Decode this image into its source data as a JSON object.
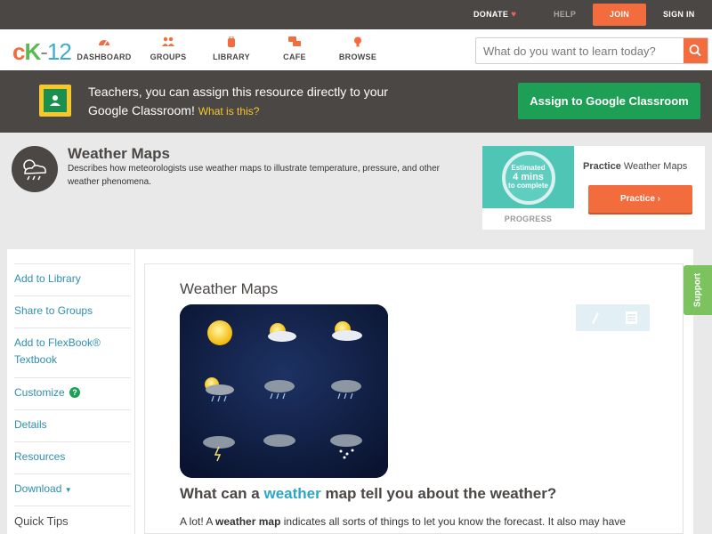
{
  "topbar": {
    "donate": "DONATE",
    "help": "HELP",
    "join": "JOIN",
    "signin": "SIGN IN"
  },
  "nav": {
    "logo": {
      "c": "c",
      "k": "K",
      "dash": "-",
      "num": "12"
    },
    "items": [
      {
        "label": "DASHBOARD",
        "icon": "speedometer-icon"
      },
      {
        "label": "GROUPS",
        "icon": "people-icon"
      },
      {
        "label": "LIBRARY",
        "icon": "backpack-icon"
      },
      {
        "label": "CAFE",
        "icon": "chat-bubbles-icon"
      },
      {
        "label": "BROWSE",
        "icon": "lightbulb-icon"
      }
    ],
    "search_placeholder": "What do you want to learn today?"
  },
  "banner": {
    "message": "Teachers, you can assign this resource directly to your Google Classroom!",
    "what_link": "What is this?",
    "assign_button": "Assign to Google Classroom"
  },
  "concept": {
    "title": "Weather Maps",
    "description": "Describes how meteorologists use weather maps to illustrate temperature, pressure, and other weather phenomena."
  },
  "practice": {
    "estimated": "Estimated",
    "minutes": "4 mins",
    "to_complete": "to complete",
    "progress_label": "PROGRESS",
    "title_bold": "Practice",
    "title_rest": "Weather Maps",
    "button": "Practice"
  },
  "sidebar": {
    "items": [
      {
        "label": "Add to Library"
      },
      {
        "label": "Share to Groups"
      },
      {
        "label": "Add to FlexBook® Textbook"
      },
      {
        "label": "Customize"
      },
      {
        "label": "Details"
      },
      {
        "label": "Resources"
      },
      {
        "label": "Download"
      }
    ],
    "quick_tips": "Quick Tips"
  },
  "lesson": {
    "title": "Weather Maps",
    "question_pre": "What can a",
    "question_hl": "weather",
    "question_post": "map tell you about the weather?",
    "body_pre": "A lot! A",
    "body_term": "weather map",
    "body_post": "indicates all sorts of things to let you know the forecast. It also may have"
  },
  "support": "Support",
  "colors": {
    "accent_orange": "#f36c3d",
    "green": "#1d9f55",
    "dark_bar": "#4a4745",
    "link_blue": "#2e8fb0"
  }
}
